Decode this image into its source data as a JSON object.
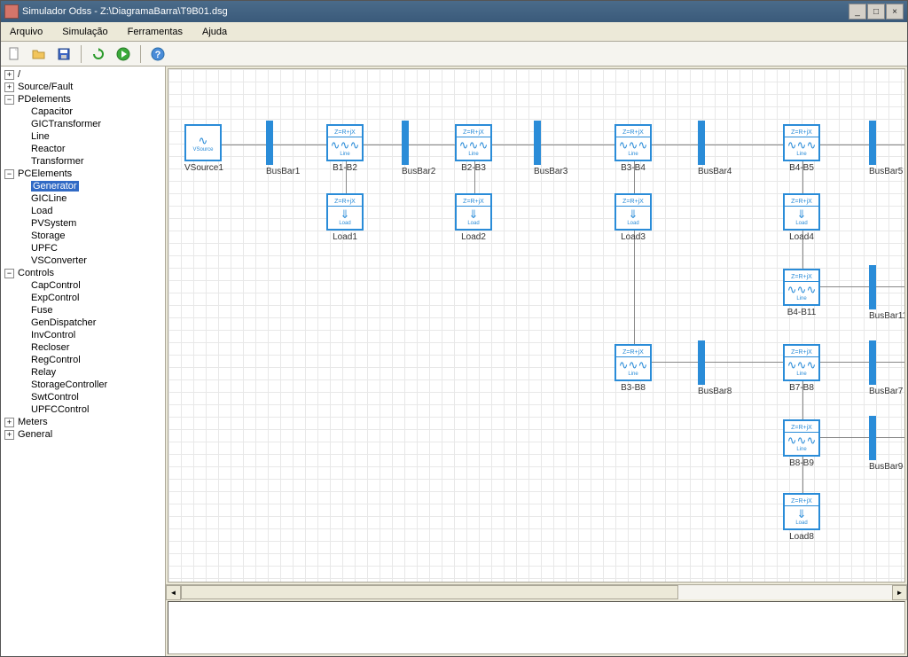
{
  "window": {
    "title": "Simulador Odss - Z:\\DiagramaBarra\\T9B01.dsg"
  },
  "menu": {
    "arquivo": "Arquivo",
    "simulacao": "Simulação",
    "ferramentas": "Ferramentas",
    "ajuda": "Ajuda"
  },
  "tree": {
    "root": "/",
    "sourceFault": "Source/Fault",
    "pdElements": "PDelements",
    "pdItems": {
      "capacitor": "Capacitor",
      "gicTransformer": "GICTransformer",
      "line": "Line",
      "reactor": "Reactor",
      "transformer": "Transformer"
    },
    "pcElements": "PCElements",
    "pcItems": {
      "generator": "Generator",
      "gicLine": "GICLine",
      "load": "Load",
      "pvSystem": "PVSystem",
      "storage": "Storage",
      "upfc": "UPFC",
      "vsConverter": "VSConverter"
    },
    "controls": "Controls",
    "controlsItems": {
      "capControl": "CapControl",
      "expControl": "ExpControl",
      "fuse": "Fuse",
      "genDispatcher": "GenDispatcher",
      "invControl": "InvControl",
      "recloser": "Recloser",
      "regControl": "RegControl",
      "relay": "Relay",
      "storageController": "StorageController",
      "swtControl": "SwtControl",
      "upfcControl": "UPFCControl"
    },
    "meters": "Meters",
    "general": "General"
  },
  "diagram": {
    "lineHeader": "Z=R+jX",
    "lineSub": "Line",
    "loadSub": "Load",
    "sourceSub": "VSource",
    "vsource1": "VSource1",
    "busbar1": "BusBar1",
    "b1b2": "B1-B2",
    "busbar2": "BusBar2",
    "b2b3": "B2-B3",
    "busbar3": "BusBar3",
    "b3b4": "B3-B4",
    "busbar4": "BusBar4",
    "b4b5": "B4-B5",
    "busbar5": "BusBar5",
    "load1": "Load1",
    "load2": "Load2",
    "load3": "Load3",
    "load4": "Load4",
    "b4b11": "B4-B11",
    "busbar11": "BusBar11",
    "b3b8": "B3-B8",
    "busbar8": "BusBar8",
    "b7b8": "B7-B8",
    "busbar7": "BusBar7",
    "b8b9": "B8-B9",
    "busbar9": "BusBar9",
    "load8": "Load8"
  },
  "colors": {
    "accent": "#2a8cd8",
    "titlebar": "#3a5a7a"
  },
  "icons": {
    "new": "new-doc-icon",
    "open": "open-folder-icon",
    "save": "save-icon",
    "refresh": "refresh-icon",
    "run": "play-icon",
    "help": "help-icon"
  }
}
